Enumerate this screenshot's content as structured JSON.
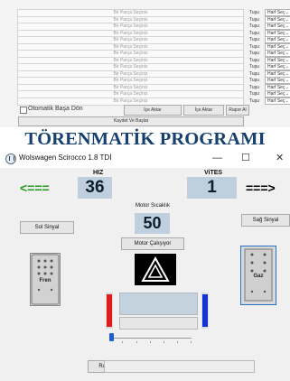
{
  "form": {
    "rows": [
      {
        "part_placeholder": "Bir Parça Seçiniz",
        "key_label": "Tuşu",
        "select_value": "Harf Seç"
      },
      {
        "part_placeholder": "Bir Parça Seçiniz",
        "key_label": "Tuşu",
        "select_value": "Harf Seç"
      },
      {
        "part_placeholder": "Bir Parça Seçiniz",
        "key_label": "Tuşu",
        "select_value": "Harf Seç"
      },
      {
        "part_placeholder": "Bir Parça Seçiniz",
        "key_label": "Tuşu",
        "select_value": "Harf Seç"
      },
      {
        "part_placeholder": "Bir Parça Seçiniz",
        "key_label": "Tuşu",
        "select_value": "Harf Seç"
      },
      {
        "part_placeholder": "Bir Parça Seçiniz",
        "key_label": "Tuşu",
        "select_value": "Harf Seç"
      },
      {
        "part_placeholder": "Bir Parça Seçiniz",
        "key_label": "Tuşu",
        "select_value": "Harf Seç"
      },
      {
        "part_placeholder": "Bir Parça Seçiniz",
        "key_label": "Tuşu",
        "select_value": "Harf Seç"
      },
      {
        "part_placeholder": "Bir Parça Seçiniz",
        "key_label": "Tuşu",
        "select_value": "Harf Seç"
      },
      {
        "part_placeholder": "Bir Parça Seçiniz",
        "key_label": "Tuşu",
        "select_value": "Harf Seç"
      },
      {
        "part_placeholder": "Bir Parça Seçiniz",
        "key_label": "Tuşu",
        "select_value": "Harf Seç"
      },
      {
        "part_placeholder": "Bir Parça Seçiniz",
        "key_label": "Tuşu",
        "select_value": "Harf Seç"
      },
      {
        "part_placeholder": "Bir Parça Seçiniz",
        "key_label": "Tuşu",
        "select_value": "Harf Seç"
      },
      {
        "part_placeholder": "Bir Parça Seçiniz",
        "key_label": "Tuşu",
        "select_value": "Harf Seç"
      }
    ],
    "auto_restart_label": "Otomatik Başa Dön",
    "import_button_1": "İçe Aktar",
    "import_button_2": "İçe Aktar",
    "report_button": "Rapor Al",
    "save_start_button": "Kaydet Ve Başlat"
  },
  "heading": "TÖRENMATİK PROGRAMI",
  "window": {
    "title": "Wolswagen Scirocco 1.8 TDİ",
    "minimize_glyph": "—",
    "maximize_glyph": "☐",
    "close_glyph": "✕"
  },
  "dashboard": {
    "speed_label": "HIZ",
    "speed_value": "36",
    "gear_label": "ViTES",
    "gear_value": "1",
    "left_arrow": "<===",
    "right_arrow": "===>",
    "engine_temp_label": "Motor Sıcaklık",
    "engine_temp_value": "50",
    "left_signal_button": "Sol Sinyal",
    "right_signal_button": "Sağ Sinyal",
    "engine_running_button": "Motor Çalışıyor",
    "brake_label": "Fren",
    "gas_label": "Gaz",
    "radio_button": "Radyo",
    "slider_value": 0,
    "colors": {
      "left_arrow": "#1f9a1f",
      "right_arrow": "#000000",
      "left_bar": "#e01b1b",
      "right_bar": "#1233d6"
    }
  }
}
